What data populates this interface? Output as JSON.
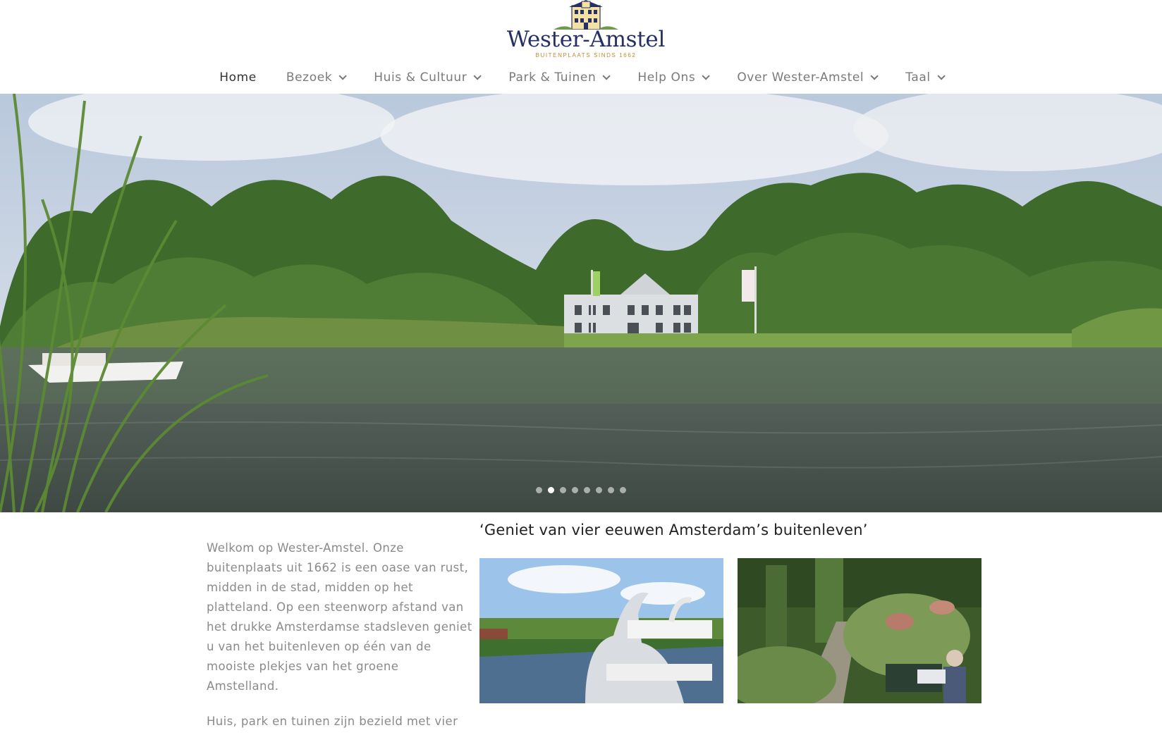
{
  "logo": {
    "name": "Wester-Amstel",
    "tagline": "BUITENPLAATS SINDS 1662",
    "icon": "manor-house-icon"
  },
  "nav": {
    "items": [
      {
        "label": "Home",
        "active": true,
        "dropdown": false
      },
      {
        "label": "Bezoek",
        "active": false,
        "dropdown": true
      },
      {
        "label": "Huis & Cultuur",
        "active": false,
        "dropdown": true
      },
      {
        "label": "Park & Tuinen",
        "active": false,
        "dropdown": true
      },
      {
        "label": "Help Ons",
        "active": false,
        "dropdown": true
      },
      {
        "label": "Over Wester-Amstel",
        "active": false,
        "dropdown": true
      },
      {
        "label": "Taal",
        "active": false,
        "dropdown": true
      }
    ]
  },
  "slider": {
    "slide_count": 8,
    "active_index": 1
  },
  "content": {
    "headline": "‘Geniet van vier eeuwen Amsterdam’s buitenleven’",
    "intro_paragraphs": [
      "Welkom op Wester-Amstel. Onze buitenplaats uit 1662 is  een oase van rust, midden in de stad, midden op het platteland. Op een steenworp afstand van het drukke Amsterdamse stadsleven geniet u van het buitenleven op één van de mooiste plekjes van het groene Amstelland.",
      "Huis, park en tuinen zijn bezield met vier"
    ]
  },
  "colors": {
    "brand_navy": "#263064",
    "brand_gold": "#c48a2a",
    "nav_text": "#7a7a7a",
    "nav_active": "#333333",
    "body_text": "#8a8a8a"
  }
}
